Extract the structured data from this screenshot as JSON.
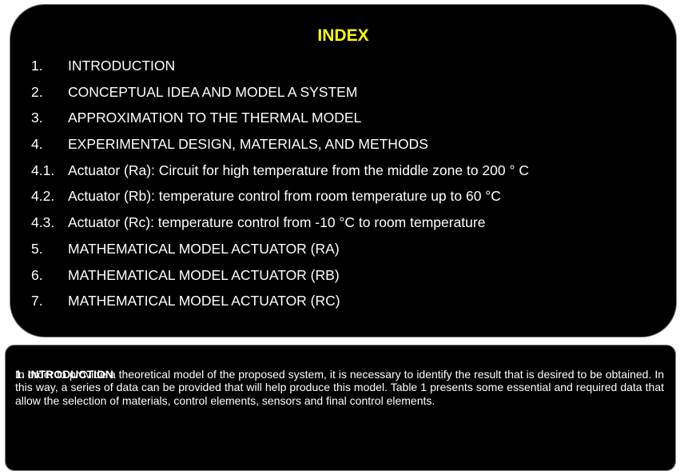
{
  "index": {
    "title": "INDEX",
    "items": [
      {
        "number": "1.",
        "text": "INTRODUCTION"
      },
      {
        "number": "2.",
        "text": "CONCEPTUAL IDEA AND MODEL A SYSTEM"
      },
      {
        "number": "3.",
        "text": "APPROXIMATION TO THE THERMAL MODEL"
      },
      {
        "number": "4.",
        "text": "EXPERIMENTAL DESIGN, MATERIALS, AND METHODS"
      },
      {
        "number": "4.1.",
        "text": "Actuator (Ra): Circuit for high temperature from the middle zone to 200 ° C"
      },
      {
        "number": "4.2.",
        "text": "Actuator (Rb): temperature control from room temperature up to 60 °C"
      },
      {
        "number": "4.3.",
        "text": "Actuator (Rc): temperature control from -10 °C to room temperature"
      },
      {
        "number": "5.",
        "text": "MATHEMATICAL MODEL ACTUATOR (RA)"
      },
      {
        "number": "6.",
        "text": "MATHEMATICAL MODEL ACTUATOR (RB)"
      },
      {
        "number": "7.",
        "text": "MATHEMATICAL MODEL ACTUATOR (RC)"
      }
    ]
  },
  "introduction": {
    "heading": "1. INTRODUCTION",
    "body": "In order to provide a theoretical model of the proposed system, it is necessary to identify the result that is desired to be obtained. In this way, a series of data can be provided that will help produce this model. Table 1 presents some essential and required data that allow the selection of materials, control elements, sensors and final control elements."
  },
  "colors": {
    "panel_background": "#000000",
    "title_color": "#ffff00",
    "text_color": "#ffffff",
    "page_background": "#ffffff"
  }
}
